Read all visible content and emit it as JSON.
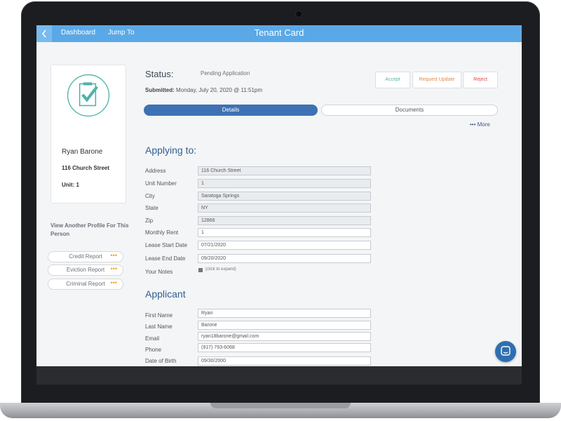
{
  "topbar": {
    "back_icon": "chevron-left-icon",
    "dashboard": "Dashboard",
    "jump_to": "Jump To",
    "title": "Tenant Card"
  },
  "profile": {
    "avatar_icon": "clipboard-check-icon",
    "name": "Ryan Barone",
    "street": "116 Church Street",
    "unit": "Unit: 1",
    "view_another": "View Another Profile For This Person",
    "reports": [
      {
        "label": "Credit Report"
      },
      {
        "label": "Eviction Report"
      },
      {
        "label": "Criminal Report"
      }
    ],
    "dots": "•••"
  },
  "status": {
    "label": "Status:",
    "value": "Pending Application",
    "submitted_label": "Submitted:",
    "submitted_value": "Monday, July 20, 2020 @ 11:51pm"
  },
  "actions": {
    "accept": "Accept",
    "request_update": "Request Update",
    "reject": "Reject"
  },
  "tabs": {
    "details": "Details",
    "documents": "Documents",
    "more": "••• More"
  },
  "applying": {
    "title": "Applying to:",
    "fields": [
      {
        "label": "Address",
        "value": "116 Church Street"
      },
      {
        "label": "Unit Number",
        "value": "1"
      },
      {
        "label": "City",
        "value": "Saratoga Springs"
      },
      {
        "label": "State",
        "value": "NY"
      },
      {
        "label": "Zip",
        "value": "12866"
      },
      {
        "label": "Monthly Rent",
        "value": "1"
      },
      {
        "label": "Lease Start Date",
        "value": "07/21/2020"
      },
      {
        "label": "Lease End Date",
        "value": "09/20/2020"
      }
    ],
    "notes_label": "Your Notes",
    "notes_hint": "(click to expand)"
  },
  "applicant": {
    "title": "Applicant",
    "fields": [
      {
        "label": "First Name",
        "value": "Ryan"
      },
      {
        "label": "Last Name",
        "value": "Barone"
      },
      {
        "label": "Email",
        "value": "ryan18barone@gmail.com"
      },
      {
        "label": "Phone",
        "value": "(917) 793-6068"
      },
      {
        "label": "Date of Birth",
        "value": "09/30/2000"
      }
    ]
  },
  "chat_icon": "chat-bubble-icon",
  "colors": {
    "topbar": "#5aa9e6",
    "tab_active": "#3e72b4",
    "accept": "#5fb3a2",
    "request_update": "#e0894c",
    "reject": "#d64b4b",
    "avatar": "#4fb3a6"
  }
}
